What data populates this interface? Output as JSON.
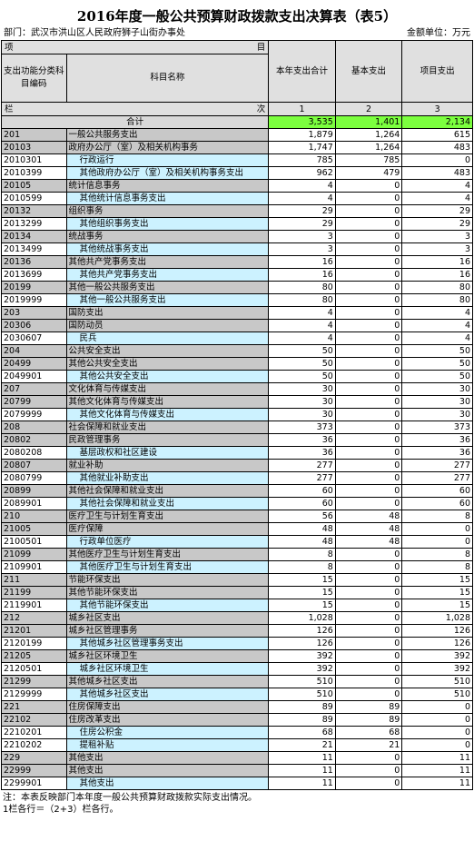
{
  "title": "2016年度一般公共预算财政拨款支出决算表（表5）",
  "dept": "部门：武汉市洪山区人民政府狮子山街办事处",
  "unit": "金额单位：万元",
  "header": {
    "xiang": "项",
    "mu": "目",
    "code": "支出功能分类科目编码",
    "name": "科目名称",
    "total": "本年支出合计",
    "basic": "基本支出",
    "project": "项目支出",
    "lan": "栏",
    "ci": "次",
    "n1": "1",
    "n2": "2",
    "n3": "3"
  },
  "total_row": {
    "label": "合计",
    "total": "3,535",
    "basic": "1,401",
    "project": "2,134"
  },
  "rows": [
    {
      "code": "201",
      "name": "一般公共服务支出",
      "total": "1,879",
      "basic": "1,264",
      "project": "615",
      "level": "l1"
    },
    {
      "code": "20103",
      "name": "政府办公厅（室）及相关机构事务",
      "total": "1,747",
      "basic": "1,264",
      "project": "483",
      "level": "l2"
    },
    {
      "code": "2010301",
      "name": "行政运行",
      "total": "785",
      "basic": "785",
      "project": "0",
      "level": "l3"
    },
    {
      "code": "2010399",
      "name": "其他政府办公厅（室）及相关机构事务支出",
      "total": "962",
      "basic": "479",
      "project": "483",
      "level": "l3"
    },
    {
      "code": "20105",
      "name": "统计信息事务",
      "total": "4",
      "basic": "0",
      "project": "4",
      "level": "l2"
    },
    {
      "code": "2010599",
      "name": "其他统计信息事务支出",
      "total": "4",
      "basic": "0",
      "project": "4",
      "level": "l3"
    },
    {
      "code": "20132",
      "name": "组织事务",
      "total": "29",
      "basic": "0",
      "project": "29",
      "level": "l2"
    },
    {
      "code": "2013299",
      "name": "其他组织事务支出",
      "total": "29",
      "basic": "0",
      "project": "29",
      "level": "l3"
    },
    {
      "code": "20134",
      "name": "统战事务",
      "total": "3",
      "basic": "0",
      "project": "3",
      "level": "l2"
    },
    {
      "code": "2013499",
      "name": "其他统战事务支出",
      "total": "3",
      "basic": "0",
      "project": "3",
      "level": "l3"
    },
    {
      "code": "20136",
      "name": "其他共产党事务支出",
      "total": "16",
      "basic": "0",
      "project": "16",
      "level": "l2"
    },
    {
      "code": "2013699",
      "name": "其他共产党事务支出",
      "total": "16",
      "basic": "0",
      "project": "16",
      "level": "l3"
    },
    {
      "code": "20199",
      "name": "其他一般公共服务支出",
      "total": "80",
      "basic": "0",
      "project": "80",
      "level": "l2"
    },
    {
      "code": "2019999",
      "name": "其他一般公共服务支出",
      "total": "80",
      "basic": "0",
      "project": "80",
      "level": "l3"
    },
    {
      "code": "203",
      "name": "国防支出",
      "total": "4",
      "basic": "0",
      "project": "4",
      "level": "l1"
    },
    {
      "code": "20306",
      "name": "国防动员",
      "total": "4",
      "basic": "0",
      "project": "4",
      "level": "l2"
    },
    {
      "code": "2030607",
      "name": "民兵",
      "total": "4",
      "basic": "0",
      "project": "4",
      "level": "l3"
    },
    {
      "code": "204",
      "name": "公共安全支出",
      "total": "50",
      "basic": "0",
      "project": "50",
      "level": "l1"
    },
    {
      "code": "20499",
      "name": "其他公共安全支出",
      "total": "50",
      "basic": "0",
      "project": "50",
      "level": "l2"
    },
    {
      "code": "2049901",
      "name": "其他公共安全支出",
      "total": "50",
      "basic": "0",
      "project": "50",
      "level": "l3"
    },
    {
      "code": "207",
      "name": "文化体育与传媒支出",
      "total": "30",
      "basic": "0",
      "project": "30",
      "level": "l1"
    },
    {
      "code": "20799",
      "name": "其他文化体育与传媒支出",
      "total": "30",
      "basic": "0",
      "project": "30",
      "level": "l2"
    },
    {
      "code": "2079999",
      "name": "其他文化体育与传媒支出",
      "total": "30",
      "basic": "0",
      "project": "30",
      "level": "l3"
    },
    {
      "code": "208",
      "name": "社会保障和就业支出",
      "total": "373",
      "basic": "0",
      "project": "373",
      "level": "l1"
    },
    {
      "code": "20802",
      "name": "民政管理事务",
      "total": "36",
      "basic": "0",
      "project": "36",
      "level": "l2"
    },
    {
      "code": "2080208",
      "name": "基层政权和社区建设",
      "total": "36",
      "basic": "0",
      "project": "36",
      "level": "l3"
    },
    {
      "code": "20807",
      "name": "就业补助",
      "total": "277",
      "basic": "0",
      "project": "277",
      "level": "l2"
    },
    {
      "code": "2080799",
      "name": "其他就业补助支出",
      "total": "277",
      "basic": "0",
      "project": "277",
      "level": "l3"
    },
    {
      "code": "20899",
      "name": "其他社会保障和就业支出",
      "total": "60",
      "basic": "0",
      "project": "60",
      "level": "l2"
    },
    {
      "code": "2089901",
      "name": "其他社会保障和就业支出",
      "total": "60",
      "basic": "0",
      "project": "60",
      "level": "l3"
    },
    {
      "code": "210",
      "name": "医疗卫生与计划生育支出",
      "total": "56",
      "basic": "48",
      "project": "8",
      "level": "l1"
    },
    {
      "code": "21005",
      "name": "医疗保障",
      "total": "48",
      "basic": "48",
      "project": "0",
      "level": "l2"
    },
    {
      "code": "2100501",
      "name": "行政单位医疗",
      "total": "48",
      "basic": "48",
      "project": "0",
      "level": "l3"
    },
    {
      "code": "21099",
      "name": "其他医疗卫生与计划生育支出",
      "total": "8",
      "basic": "0",
      "project": "8",
      "level": "l2"
    },
    {
      "code": "2109901",
      "name": "其他医疗卫生与计划生育支出",
      "total": "8",
      "basic": "0",
      "project": "8",
      "level": "l3"
    },
    {
      "code": "211",
      "name": "节能环保支出",
      "total": "15",
      "basic": "0",
      "project": "15",
      "level": "l1"
    },
    {
      "code": "21199",
      "name": "其他节能环保支出",
      "total": "15",
      "basic": "0",
      "project": "15",
      "level": "l2"
    },
    {
      "code": "2119901",
      "name": "其他节能环保支出",
      "total": "15",
      "basic": "0",
      "project": "15",
      "level": "l3"
    },
    {
      "code": "212",
      "name": "城乡社区支出",
      "total": "1,028",
      "basic": "0",
      "project": "1,028",
      "level": "l1"
    },
    {
      "code": "21201",
      "name": "城乡社区管理事务",
      "total": "126",
      "basic": "0",
      "project": "126",
      "level": "l2"
    },
    {
      "code": "2120199",
      "name": "其他城乡社区管理事务支出",
      "total": "126",
      "basic": "0",
      "project": "126",
      "level": "l3"
    },
    {
      "code": "21205",
      "name": "城乡社区环境卫生",
      "total": "392",
      "basic": "0",
      "project": "392",
      "level": "l2"
    },
    {
      "code": "2120501",
      "name": "城乡社区环境卫生",
      "total": "392",
      "basic": "0",
      "project": "392",
      "level": "l3"
    },
    {
      "code": "21299",
      "name": "其他城乡社区支出",
      "total": "510",
      "basic": "0",
      "project": "510",
      "level": "l2"
    },
    {
      "code": "2129999",
      "name": "其他城乡社区支出",
      "total": "510",
      "basic": "0",
      "project": "510",
      "level": "l3"
    },
    {
      "code": "221",
      "name": "住房保障支出",
      "total": "89",
      "basic": "89",
      "project": "0",
      "level": "l1"
    },
    {
      "code": "22102",
      "name": "住房改革支出",
      "total": "89",
      "basic": "89",
      "project": "0",
      "level": "l2"
    },
    {
      "code": "2210201",
      "name": "住房公积金",
      "total": "68",
      "basic": "68",
      "project": "0",
      "level": "l3"
    },
    {
      "code": "2210202",
      "name": "提租补贴",
      "total": "21",
      "basic": "21",
      "project": "0",
      "level": "l3"
    },
    {
      "code": "229",
      "name": "其他支出",
      "total": "11",
      "basic": "0",
      "project": "11",
      "level": "l1"
    },
    {
      "code": "22999",
      "name": "其他支出",
      "total": "11",
      "basic": "0",
      "project": "11",
      "level": "l2"
    },
    {
      "code": "2299901",
      "name": "其他支出",
      "total": "11",
      "basic": "0",
      "project": "11",
      "level": "l3"
    }
  ],
  "notes": [
    "注：本表反映部门本年度一般公共预算财政拨款实际支出情况。",
    "1栏各行＝（2+3）栏各行。"
  ]
}
